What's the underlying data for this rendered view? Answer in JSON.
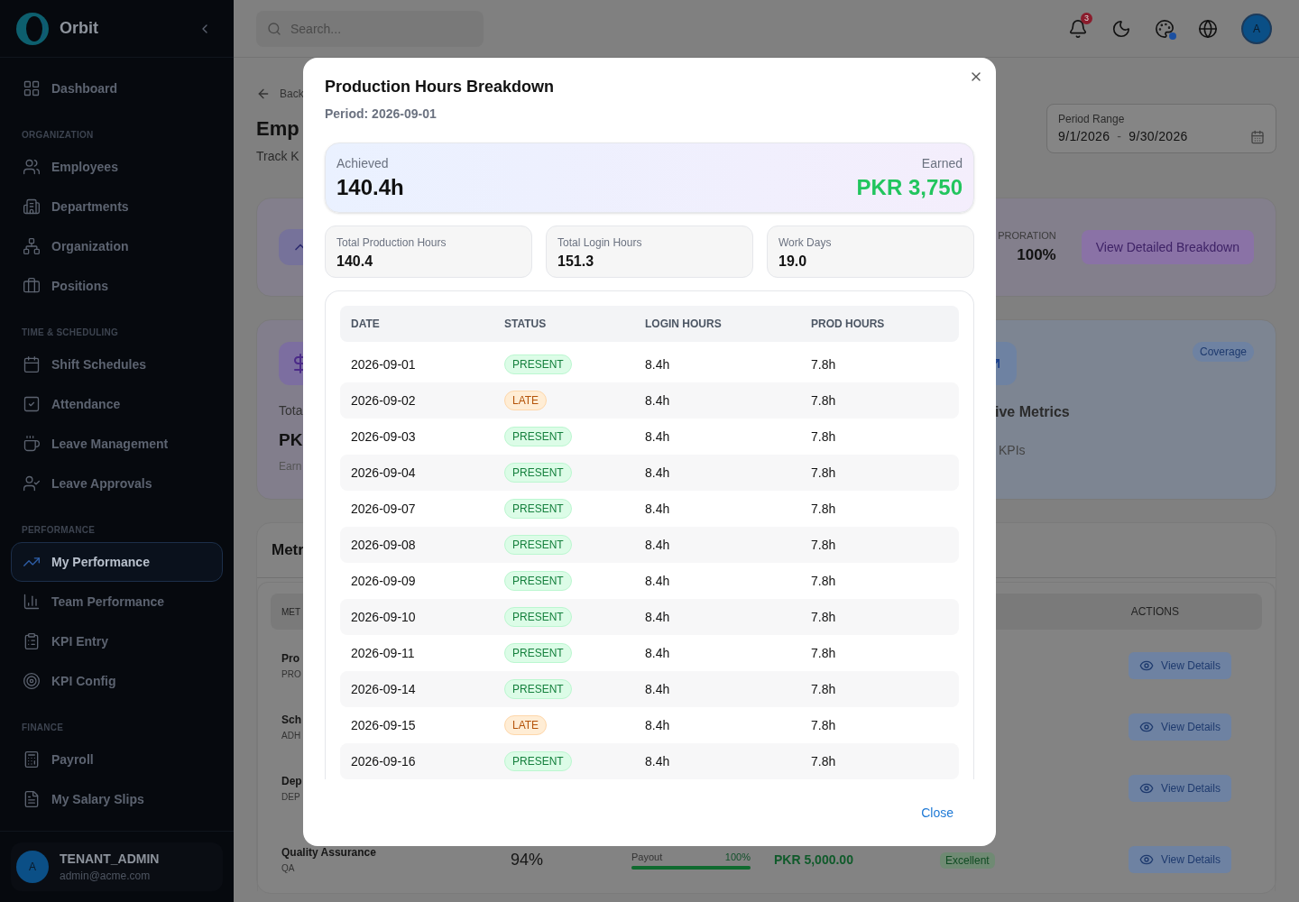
{
  "sidebar": {
    "brand": "Orbit",
    "top_item": {
      "label": "Dashboard",
      "selected": false
    },
    "sections": [
      {
        "heading": "ORGANIZATION",
        "items": [
          {
            "label": "Employees",
            "selected": false
          },
          {
            "label": "Departments",
            "selected": false
          },
          {
            "label": "Organization",
            "selected": false
          },
          {
            "label": "Positions",
            "selected": false
          }
        ]
      },
      {
        "heading": "TIME & SCHEDULING",
        "items": [
          {
            "label": "Shift Schedules",
            "selected": false
          },
          {
            "label": "Attendance",
            "selected": false
          },
          {
            "label": "Leave Management",
            "selected": false
          },
          {
            "label": "Leave Approvals",
            "selected": false
          }
        ]
      },
      {
        "heading": "PERFORMANCE",
        "items": [
          {
            "label": "My Performance",
            "selected": true
          },
          {
            "label": "Team Performance",
            "selected": false
          },
          {
            "label": "KPI Entry",
            "selected": false
          },
          {
            "label": "KPI Config",
            "selected": false
          }
        ]
      },
      {
        "heading": "FINANCE",
        "items": [
          {
            "label": "Payroll",
            "selected": false
          },
          {
            "label": "My Salary Slips",
            "selected": false
          }
        ]
      }
    ],
    "user": {
      "avatar": "A",
      "name": "TENANT_ADMIN",
      "email": "admin@acme.com"
    }
  },
  "header": {
    "search_placeholder": "Search...",
    "notification_count": "3",
    "avatar": "A"
  },
  "page": {
    "back": "Back",
    "title": "Emp",
    "subtitle": "Track K",
    "period_range": {
      "label": "Period Range",
      "start": "9/1/2026",
      "separator": "-",
      "end": "9/30/2026"
    },
    "production_card": {
      "proration_label": "PRORATION",
      "proration_value": "100%",
      "button": "View Detailed Breakdown"
    },
    "earnings_card": {
      "title": "Tota",
      "value": "PK",
      "caption": "Earn"
    },
    "metrics_card": {
      "badge": "Coverage",
      "title": "ive Metrics",
      "caption": "KPIs"
    },
    "metrics_table": {
      "title": "Metr",
      "columns": [
        "MET",
        "ACTIONS"
      ],
      "rows": [
        {
          "name": "Pro",
          "code": "PRO",
          "action": "View Details"
        },
        {
          "name": "Sch",
          "code": "ADH",
          "action": "View Details"
        },
        {
          "name": "Dep",
          "code": "DEP",
          "action": "View Details"
        },
        {
          "name": "Quality Assurance",
          "code": "QA",
          "score": "94%",
          "payout_label": "Payout",
          "payout_percent": "100%",
          "level": 1,
          "amount": "PKR 5,000.00",
          "rating": "Excellent",
          "action": "View Details"
        }
      ]
    }
  },
  "modal": {
    "title": "Production Hours Breakdown",
    "period": "Period: 2026-09-01",
    "summary": {
      "achieved_label": "Achieved",
      "achieved": "140.4h",
      "earned_label": "Earned",
      "earned": "PKR 3,750"
    },
    "stats": [
      {
        "label": "Total Production Hours",
        "value": "140.4"
      },
      {
        "label": "Total Login Hours",
        "value": "151.3"
      },
      {
        "label": "Work Days",
        "value": "19.0"
      }
    ],
    "columns": [
      "DATE",
      "STATUS",
      "LOGIN HOURS",
      "PROD HOURS"
    ],
    "rows": [
      {
        "date": "2026-09-01",
        "status": "PRESENT",
        "kind": "present",
        "login": "8.4h",
        "prod": "7.8h"
      },
      {
        "date": "2026-09-02",
        "status": "LATE",
        "kind": "late",
        "login": "8.4h",
        "prod": "7.8h"
      },
      {
        "date": "2026-09-03",
        "status": "PRESENT",
        "kind": "present",
        "login": "8.4h",
        "prod": "7.8h"
      },
      {
        "date": "2026-09-04",
        "status": "PRESENT",
        "kind": "present",
        "login": "8.4h",
        "prod": "7.8h"
      },
      {
        "date": "2026-09-07",
        "status": "PRESENT",
        "kind": "present",
        "login": "8.4h",
        "prod": "7.8h"
      },
      {
        "date": "2026-09-08",
        "status": "PRESENT",
        "kind": "present",
        "login": "8.4h",
        "prod": "7.8h"
      },
      {
        "date": "2026-09-09",
        "status": "PRESENT",
        "kind": "present",
        "login": "8.4h",
        "prod": "7.8h"
      },
      {
        "date": "2026-09-10",
        "status": "PRESENT",
        "kind": "present",
        "login": "8.4h",
        "prod": "7.8h"
      },
      {
        "date": "2026-09-11",
        "status": "PRESENT",
        "kind": "present",
        "login": "8.4h",
        "prod": "7.8h"
      },
      {
        "date": "2026-09-14",
        "status": "PRESENT",
        "kind": "present",
        "login": "8.4h",
        "prod": "7.8h"
      },
      {
        "date": "2026-09-15",
        "status": "LATE",
        "kind": "late",
        "login": "8.4h",
        "prod": "7.8h"
      },
      {
        "date": "2026-09-16",
        "status": "PRESENT",
        "kind": "present",
        "login": "8.4h",
        "prod": "7.8h"
      }
    ],
    "close": "Close"
  }
}
